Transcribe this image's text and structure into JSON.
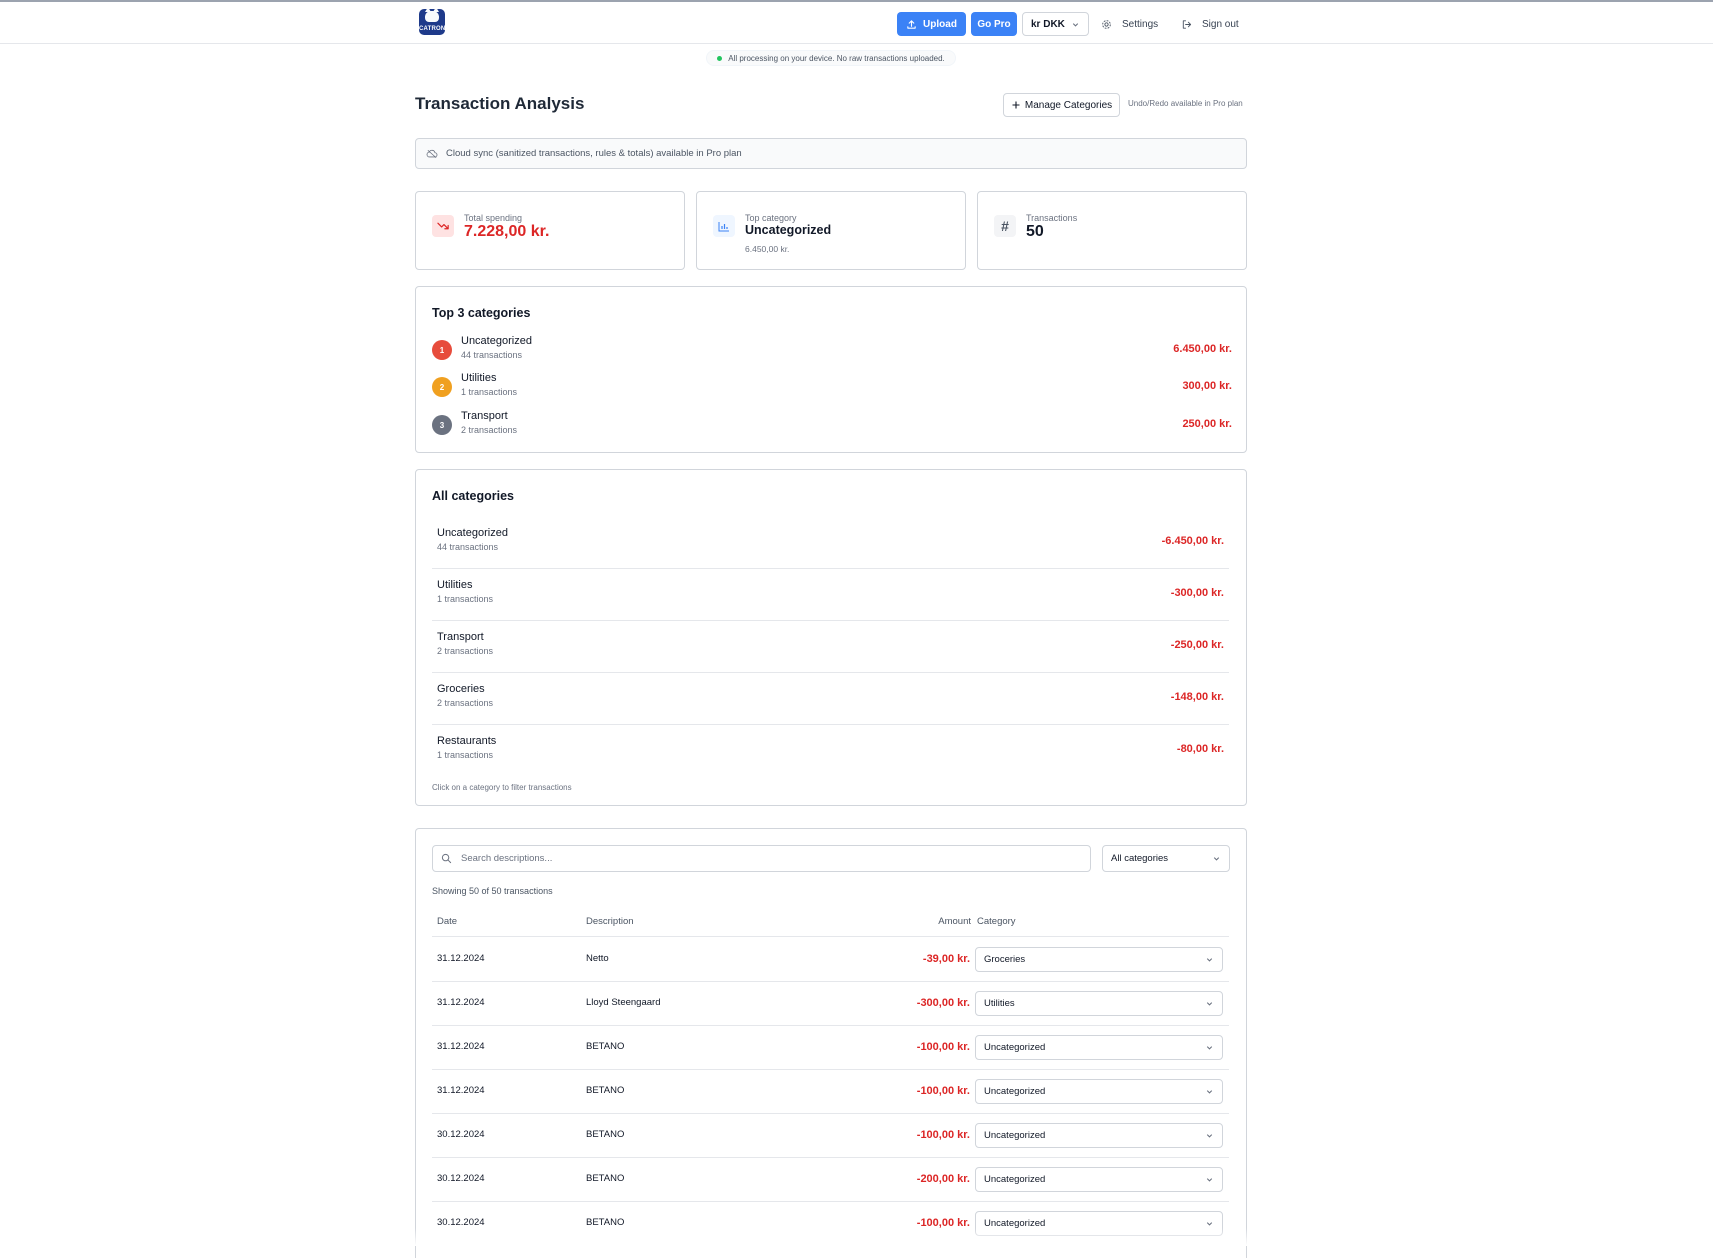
{
  "header": {
    "logo_text": "CATRON",
    "upload_label": "Upload",
    "gopro_label": "Go Pro",
    "currency": "kr DKK",
    "settings_label": "Settings",
    "signout_label": "Sign out"
  },
  "notice": "All processing on your device. No raw transactions uploaded.",
  "page": {
    "title": "Transaction Analysis",
    "manage_label": "Manage Categories",
    "undo_note": "Undo/Redo available in Pro plan",
    "cloud_banner": "Cloud sync (sanitized transactions, rules & totals) available in Pro plan"
  },
  "stats": [
    {
      "label": "Total spending",
      "value": "7.228,00 kr.",
      "sub": ""
    },
    {
      "label": "Top category",
      "value": "Uncategorized",
      "sub": "6.450,00 kr."
    },
    {
      "label": "Transactions",
      "value": "50",
      "sub": ""
    }
  ],
  "top3": {
    "title": "Top 3 categories",
    "items": [
      {
        "rank": "1",
        "name": "Uncategorized",
        "count": "44 transactions",
        "amount": "6.450,00 kr.",
        "color": "#e74c3c"
      },
      {
        "rank": "2",
        "name": "Utilities",
        "count": "1 transactions",
        "amount": "300,00 kr.",
        "color": "#f0a020"
      },
      {
        "rank": "3",
        "name": "Transport",
        "count": "2 transactions",
        "amount": "250,00 kr.",
        "color": "#6b7280"
      }
    ]
  },
  "all_categories": {
    "title": "All categories",
    "items": [
      {
        "name": "Uncategorized",
        "count": "44 transactions",
        "amount": "-6.450,00 kr."
      },
      {
        "name": "Utilities",
        "count": "1 transactions",
        "amount": "-300,00 kr."
      },
      {
        "name": "Transport",
        "count": "2 transactions",
        "amount": "-250,00 kr."
      },
      {
        "name": "Groceries",
        "count": "2 transactions",
        "amount": "-148,00 kr."
      },
      {
        "name": "Restaurants",
        "count": "1 transactions",
        "amount": "-80,00 kr."
      }
    ],
    "hint": "Click on a category to filter transactions"
  },
  "transactions": {
    "search_placeholder": "Search descriptions...",
    "filter_value": "All categories",
    "showing": "Showing 50 of 50 transactions",
    "columns": {
      "date": "Date",
      "description": "Description",
      "amount": "Amount",
      "category": "Category"
    },
    "rows": [
      {
        "date": "31.12.2024",
        "description": "Netto",
        "amount": "-39,00 kr.",
        "category": "Groceries"
      },
      {
        "date": "31.12.2024",
        "description": "Lloyd Steengaard",
        "amount": "-300,00 kr.",
        "category": "Utilities"
      },
      {
        "date": "31.12.2024",
        "description": "BETANO",
        "amount": "-100,00 kr.",
        "category": "Uncategorized"
      },
      {
        "date": "31.12.2024",
        "description": "BETANO",
        "amount": "-100,00 kr.",
        "category": "Uncategorized"
      },
      {
        "date": "30.12.2024",
        "description": "BETANO",
        "amount": "-100,00 kr.",
        "category": "Uncategorized"
      },
      {
        "date": "30.12.2024",
        "description": "BETANO",
        "amount": "-200,00 kr.",
        "category": "Uncategorized"
      },
      {
        "date": "30.12.2024",
        "description": "BETANO",
        "amount": "-100,00 kr.",
        "category": "Uncategorized"
      }
    ]
  },
  "colors": {
    "accent": "#3b82f6",
    "negative": "#dc2626",
    "success": "#22c55e"
  }
}
